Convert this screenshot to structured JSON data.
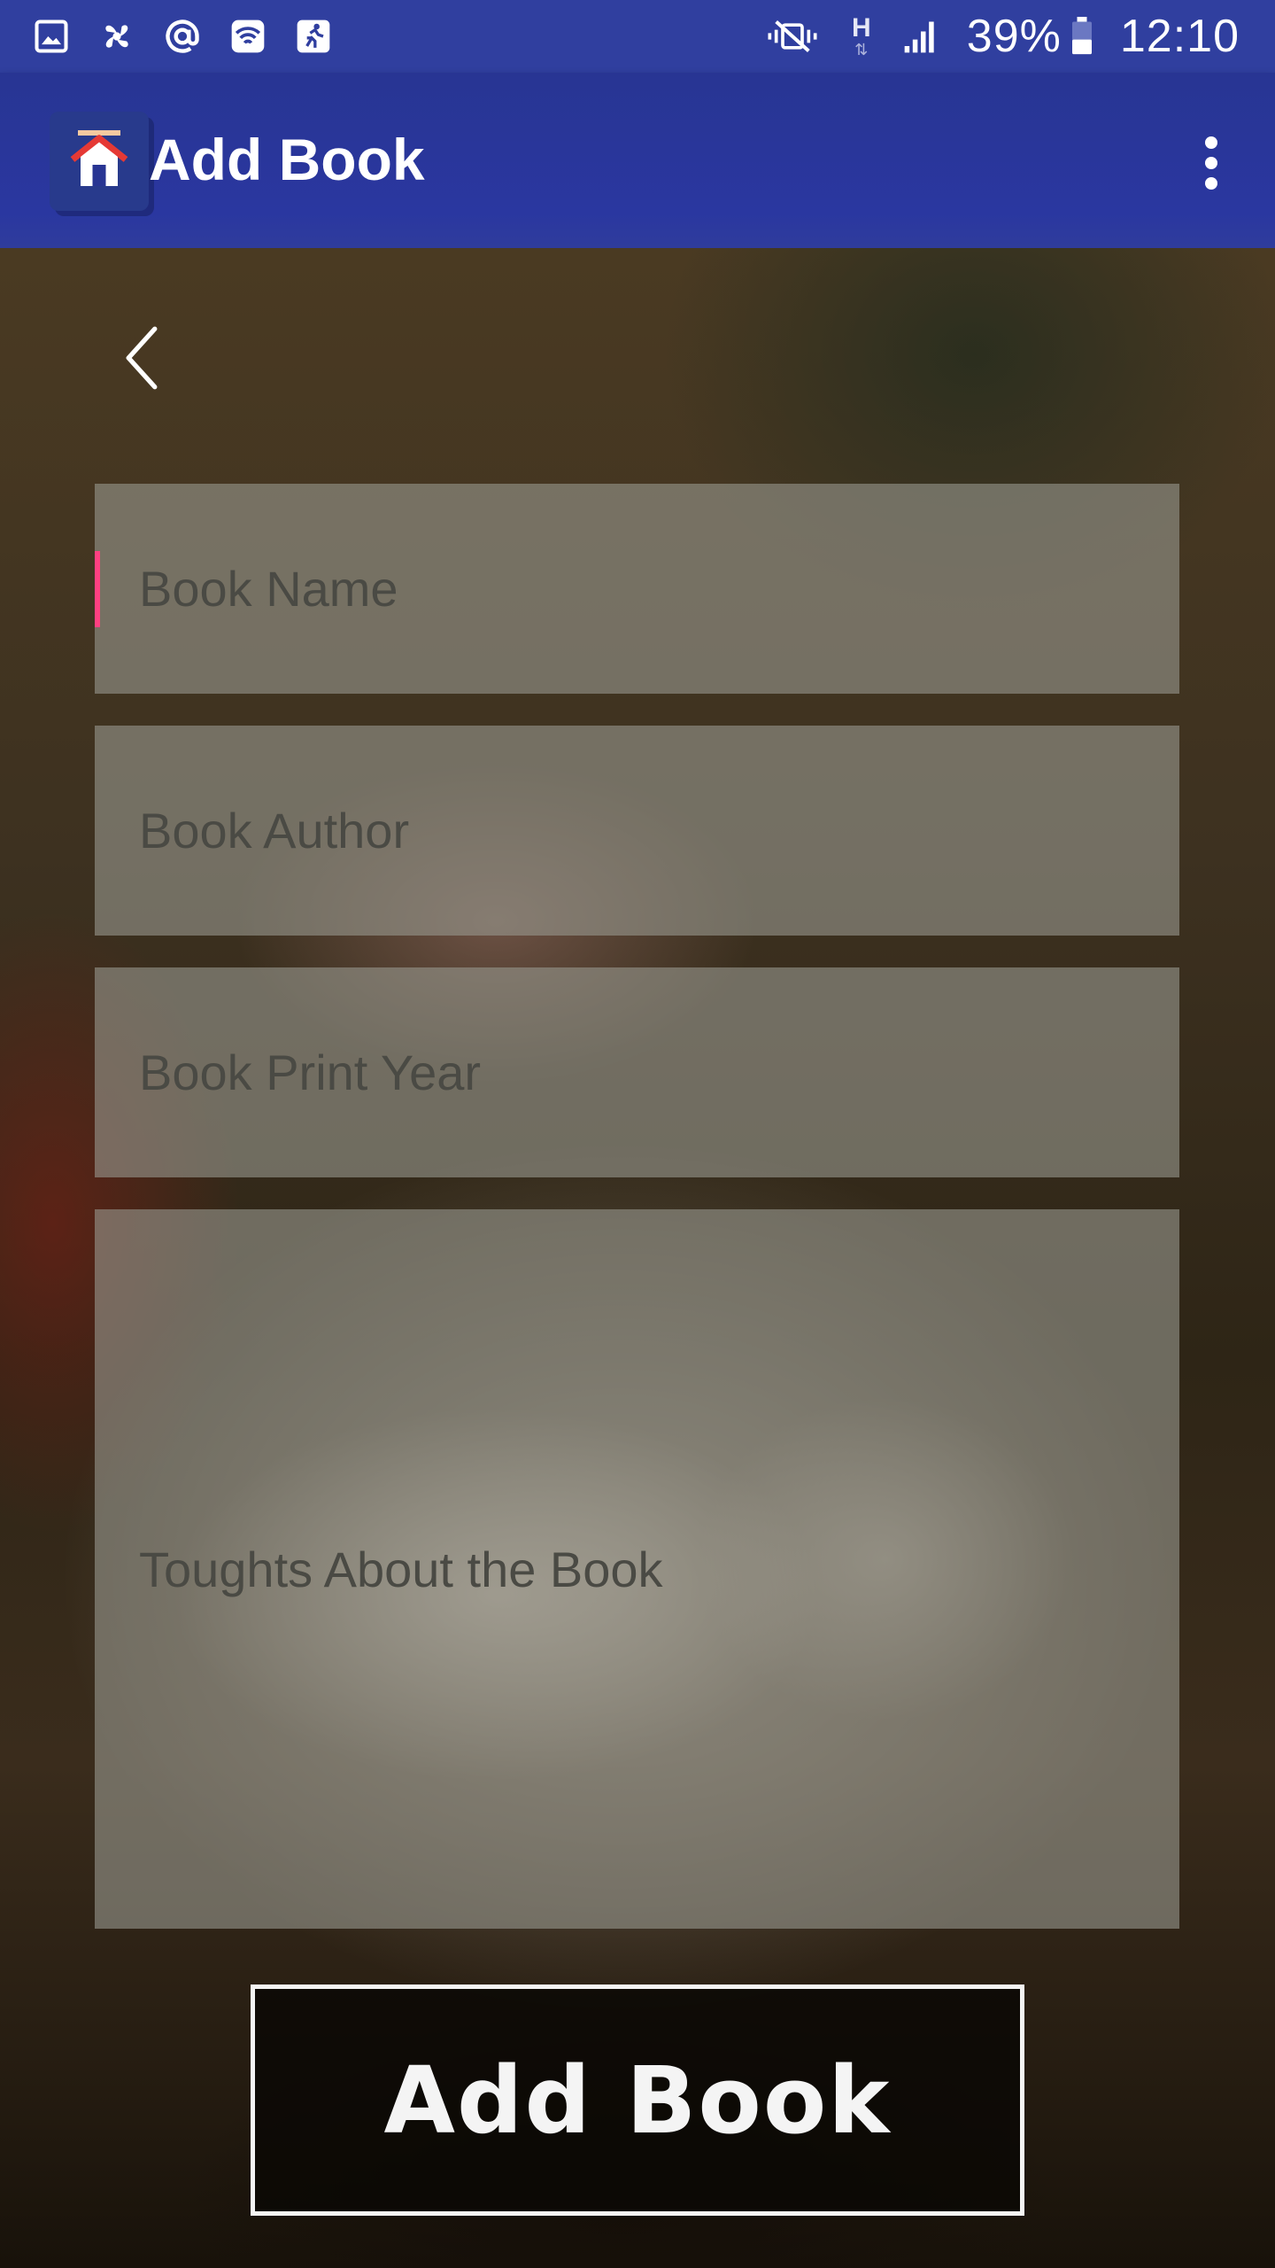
{
  "status_bar": {
    "battery": "39%",
    "time": "12:10",
    "network_type": "H",
    "left_icons": [
      "image-icon",
      "pinwheel-icon",
      "at-sign-icon",
      "wifi-icon",
      "runner-icon"
    ],
    "right_icons": [
      "vibrate-mute-icon",
      "network-h-icon",
      "signal-icon",
      "battery-icon"
    ]
  },
  "app_bar": {
    "title": "Add Book",
    "logo_icon": "home-icon",
    "menu_icon": "overflow-menu-icon",
    "color": "#283593"
  },
  "form": {
    "back_icon": "chevron-left-icon",
    "book_name_placeholder": "Book Name",
    "book_author_placeholder": "Book Author",
    "book_print_year_placeholder": "Book Print Year",
    "thoughts_placeholder": "Toughts About the Book",
    "focus_accent": "#ff4081"
  },
  "submit_button": {
    "label": "Add Book"
  }
}
